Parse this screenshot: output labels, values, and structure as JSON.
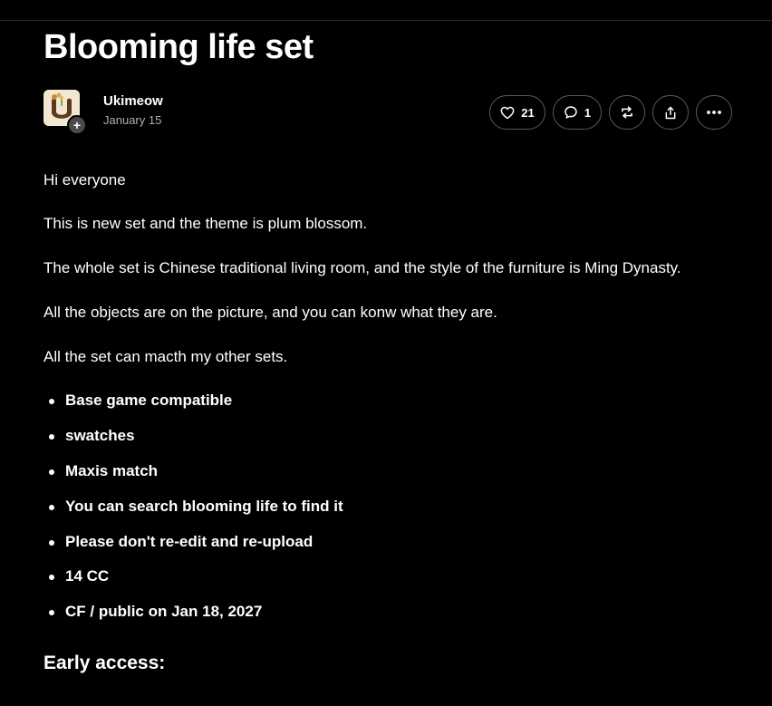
{
  "post": {
    "title": "Blooming life set",
    "author": {
      "name": "Ukimeow",
      "avatar_icon": "ukimeow-avatar",
      "follow_icon": "plus-icon"
    },
    "date": "January 15",
    "actions": {
      "likes_count": "21",
      "replies_count": "1",
      "reblog_icon": "reblog-icon",
      "share_icon": "share-icon",
      "more_icon": "more-icon"
    },
    "paragraphs": [
      "Hi everyone",
      "This is new set and the theme is plum blossom.",
      "The whole set is Chinese traditional living room, and the style of the furniture is Ming Dynasty.",
      "All the objects are on the picture, and you can konw what they are.",
      "All the set can macth my other sets."
    ],
    "bullets": [
      "Base game compatible",
      "swatches",
      "Maxis match",
      "You can search blooming life to find it",
      "Please don't re-edit and re-upload",
      "14 CC",
      "CF / public on Jan 18, 2027"
    ],
    "section_heading": "Early access:"
  },
  "colors": {
    "background": "#000000",
    "text": "#ffffff",
    "muted_text": "#b0b0b0",
    "pill_border": "#5a5a5a"
  }
}
